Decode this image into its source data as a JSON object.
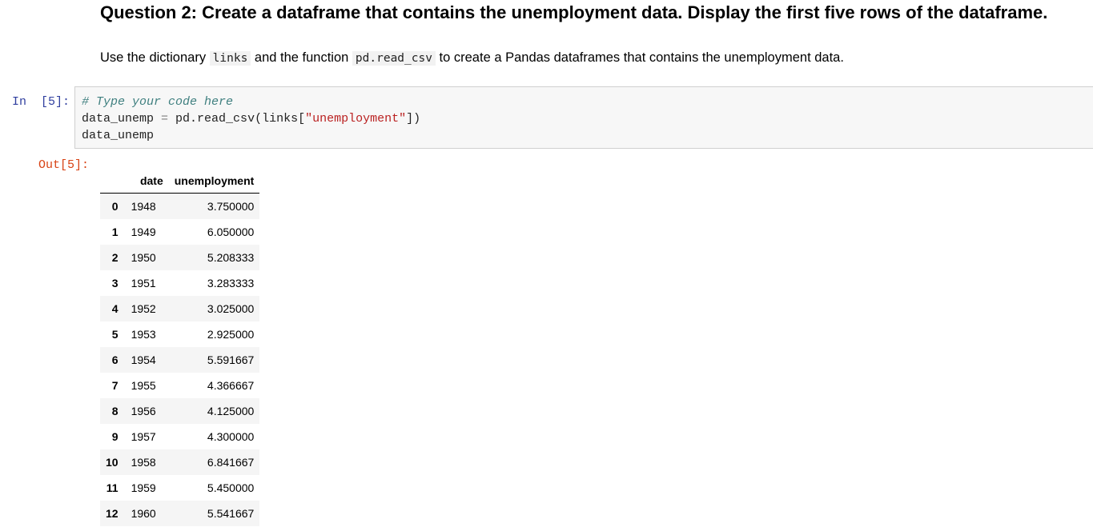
{
  "markdown": {
    "heading": "Question 2: Create a dataframe that contains the unemployment data. Display the first five rows of the dataframe.",
    "para_before": "Use the dictionary ",
    "code_links": "links",
    "para_mid": " and the function ",
    "code_fn": "pd.read_csv",
    "para_after": " to create a Pandas dataframes that contains the unemployment data."
  },
  "input_cell": {
    "prompt": "In  [5]:",
    "comment": "# Type your code here",
    "line2_var": "data_unemp ",
    "line2_op": "=",
    "line2_call": " pd.read_csv(links[",
    "line2_str": "\"unemployment\"",
    "line2_end": "])",
    "line3": "data_unemp"
  },
  "output_cell": {
    "prompt": "Out[5]:",
    "columns": [
      "",
      "date",
      "unemployment"
    ],
    "rows": [
      {
        "index": "0",
        "date": "1948",
        "unemployment": "3.750000"
      },
      {
        "index": "1",
        "date": "1949",
        "unemployment": "6.050000"
      },
      {
        "index": "2",
        "date": "1950",
        "unemployment": "5.208333"
      },
      {
        "index": "3",
        "date": "1951",
        "unemployment": "3.283333"
      },
      {
        "index": "4",
        "date": "1952",
        "unemployment": "3.025000"
      },
      {
        "index": "5",
        "date": "1953",
        "unemployment": "2.925000"
      },
      {
        "index": "6",
        "date": "1954",
        "unemployment": "5.591667"
      },
      {
        "index": "7",
        "date": "1955",
        "unemployment": "4.366667"
      },
      {
        "index": "8",
        "date": "1956",
        "unemployment": "4.125000"
      },
      {
        "index": "9",
        "date": "1957",
        "unemployment": "4.300000"
      },
      {
        "index": "10",
        "date": "1958",
        "unemployment": "6.841667"
      },
      {
        "index": "11",
        "date": "1959",
        "unemployment": "5.450000"
      },
      {
        "index": "12",
        "date": "1960",
        "unemployment": "5.541667"
      }
    ]
  }
}
